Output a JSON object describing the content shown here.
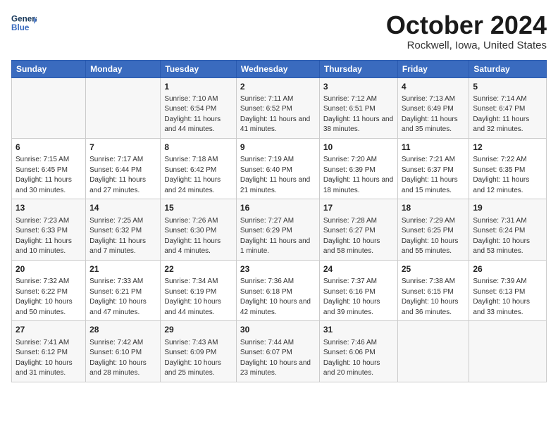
{
  "header": {
    "logo_line1": "General",
    "logo_line2": "Blue",
    "title": "October 2024",
    "subtitle": "Rockwell, Iowa, United States"
  },
  "days_of_week": [
    "Sunday",
    "Monday",
    "Tuesday",
    "Wednesday",
    "Thursday",
    "Friday",
    "Saturday"
  ],
  "weeks": [
    [
      {
        "day": "",
        "info": ""
      },
      {
        "day": "",
        "info": ""
      },
      {
        "day": "1",
        "info": "Sunrise: 7:10 AM\nSunset: 6:54 PM\nDaylight: 11 hours and 44 minutes."
      },
      {
        "day": "2",
        "info": "Sunrise: 7:11 AM\nSunset: 6:52 PM\nDaylight: 11 hours and 41 minutes."
      },
      {
        "day": "3",
        "info": "Sunrise: 7:12 AM\nSunset: 6:51 PM\nDaylight: 11 hours and 38 minutes."
      },
      {
        "day": "4",
        "info": "Sunrise: 7:13 AM\nSunset: 6:49 PM\nDaylight: 11 hours and 35 minutes."
      },
      {
        "day": "5",
        "info": "Sunrise: 7:14 AM\nSunset: 6:47 PM\nDaylight: 11 hours and 32 minutes."
      }
    ],
    [
      {
        "day": "6",
        "info": "Sunrise: 7:15 AM\nSunset: 6:45 PM\nDaylight: 11 hours and 30 minutes."
      },
      {
        "day": "7",
        "info": "Sunrise: 7:17 AM\nSunset: 6:44 PM\nDaylight: 11 hours and 27 minutes."
      },
      {
        "day": "8",
        "info": "Sunrise: 7:18 AM\nSunset: 6:42 PM\nDaylight: 11 hours and 24 minutes."
      },
      {
        "day": "9",
        "info": "Sunrise: 7:19 AM\nSunset: 6:40 PM\nDaylight: 11 hours and 21 minutes."
      },
      {
        "day": "10",
        "info": "Sunrise: 7:20 AM\nSunset: 6:39 PM\nDaylight: 11 hours and 18 minutes."
      },
      {
        "day": "11",
        "info": "Sunrise: 7:21 AM\nSunset: 6:37 PM\nDaylight: 11 hours and 15 minutes."
      },
      {
        "day": "12",
        "info": "Sunrise: 7:22 AM\nSunset: 6:35 PM\nDaylight: 11 hours and 12 minutes."
      }
    ],
    [
      {
        "day": "13",
        "info": "Sunrise: 7:23 AM\nSunset: 6:33 PM\nDaylight: 11 hours and 10 minutes."
      },
      {
        "day": "14",
        "info": "Sunrise: 7:25 AM\nSunset: 6:32 PM\nDaylight: 11 hours and 7 minutes."
      },
      {
        "day": "15",
        "info": "Sunrise: 7:26 AM\nSunset: 6:30 PM\nDaylight: 11 hours and 4 minutes."
      },
      {
        "day": "16",
        "info": "Sunrise: 7:27 AM\nSunset: 6:29 PM\nDaylight: 11 hours and 1 minute."
      },
      {
        "day": "17",
        "info": "Sunrise: 7:28 AM\nSunset: 6:27 PM\nDaylight: 10 hours and 58 minutes."
      },
      {
        "day": "18",
        "info": "Sunrise: 7:29 AM\nSunset: 6:25 PM\nDaylight: 10 hours and 55 minutes."
      },
      {
        "day": "19",
        "info": "Sunrise: 7:31 AM\nSunset: 6:24 PM\nDaylight: 10 hours and 53 minutes."
      }
    ],
    [
      {
        "day": "20",
        "info": "Sunrise: 7:32 AM\nSunset: 6:22 PM\nDaylight: 10 hours and 50 minutes."
      },
      {
        "day": "21",
        "info": "Sunrise: 7:33 AM\nSunset: 6:21 PM\nDaylight: 10 hours and 47 minutes."
      },
      {
        "day": "22",
        "info": "Sunrise: 7:34 AM\nSunset: 6:19 PM\nDaylight: 10 hours and 44 minutes."
      },
      {
        "day": "23",
        "info": "Sunrise: 7:36 AM\nSunset: 6:18 PM\nDaylight: 10 hours and 42 minutes."
      },
      {
        "day": "24",
        "info": "Sunrise: 7:37 AM\nSunset: 6:16 PM\nDaylight: 10 hours and 39 minutes."
      },
      {
        "day": "25",
        "info": "Sunrise: 7:38 AM\nSunset: 6:15 PM\nDaylight: 10 hours and 36 minutes."
      },
      {
        "day": "26",
        "info": "Sunrise: 7:39 AM\nSunset: 6:13 PM\nDaylight: 10 hours and 33 minutes."
      }
    ],
    [
      {
        "day": "27",
        "info": "Sunrise: 7:41 AM\nSunset: 6:12 PM\nDaylight: 10 hours and 31 minutes."
      },
      {
        "day": "28",
        "info": "Sunrise: 7:42 AM\nSunset: 6:10 PM\nDaylight: 10 hours and 28 minutes."
      },
      {
        "day": "29",
        "info": "Sunrise: 7:43 AM\nSunset: 6:09 PM\nDaylight: 10 hours and 25 minutes."
      },
      {
        "day": "30",
        "info": "Sunrise: 7:44 AM\nSunset: 6:07 PM\nDaylight: 10 hours and 23 minutes."
      },
      {
        "day": "31",
        "info": "Sunrise: 7:46 AM\nSunset: 6:06 PM\nDaylight: 10 hours and 20 minutes."
      },
      {
        "day": "",
        "info": ""
      },
      {
        "day": "",
        "info": ""
      }
    ]
  ]
}
